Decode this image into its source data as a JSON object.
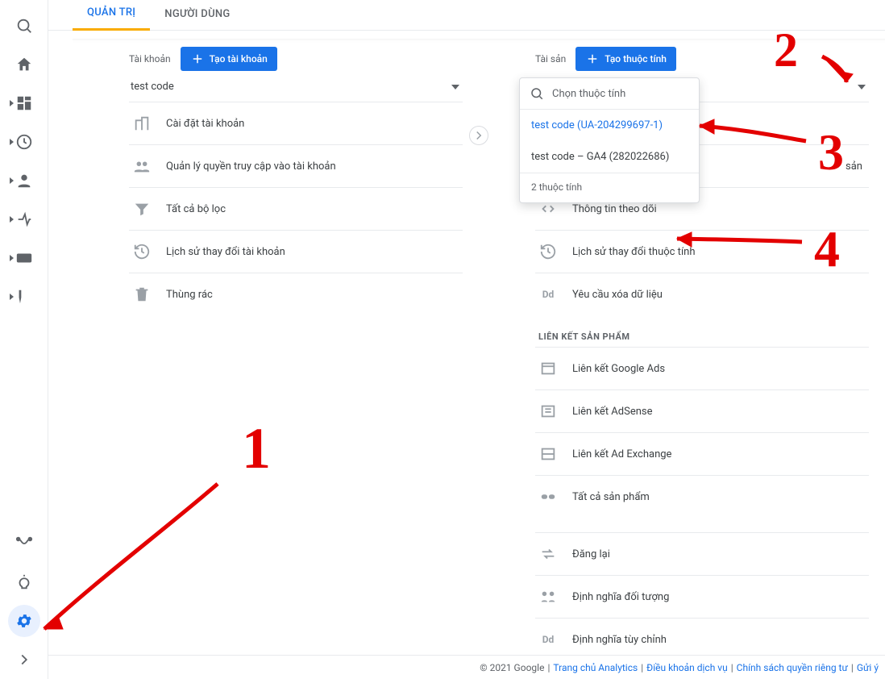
{
  "tabs": {
    "admin": "QUẢN TRỊ",
    "user": "NGƯỜI DÙNG"
  },
  "account": {
    "heading": "Tài khoản",
    "create_btn": "Tạo tài khoản",
    "selected": "test code",
    "items": {
      "settings": "Cài đặt tài khoản",
      "access": "Quản lý quyền truy cập vào tài khoản",
      "filters": "Tất cả bộ lọc",
      "history": "Lịch sử thay đổi tài khoản",
      "trash": "Thùng rác"
    }
  },
  "property": {
    "heading": "Tài sản",
    "create_btn": "Tạo thuộc tính",
    "dropdown": {
      "placeholder": "Chọn thuộc tính",
      "option_selected": "test code (UA-204299697-1)",
      "option_ga4": "test code – GA4 (282022686)",
      "footer": "2 thuộc tính"
    },
    "items": {
      "partial_hidden": "sản",
      "tracking_info": "Thông tin theo dõi",
      "history": "Lịch sử thay đổi thuộc tính",
      "data_delete": "Yêu cầu xóa dữ liệu"
    },
    "link_heading": "LIÊN KẾT SẢN PHẨM",
    "links": {
      "google_ads": "Liên kết Google Ads",
      "adsense": "Liên kết AdSense",
      "ad_exchange": "Liên kết Ad Exchange",
      "all_products": "Tất cả sản phẩm"
    },
    "more": {
      "postback": "Đăng lại",
      "audience": "Định nghĩa đối tượng",
      "custom_def": "Định nghĩa tùy chỉnh"
    }
  },
  "footer": {
    "copyright": "© 2021 Google",
    "home": "Trang chủ Analytics",
    "terms": "Điều khoản dịch vụ",
    "privacy": "Chính sách quyền riêng tư",
    "feedback": "Gửi ý"
  },
  "annotations": {
    "n1": "1",
    "n2": "2",
    "n3": "3",
    "n4": "4"
  }
}
